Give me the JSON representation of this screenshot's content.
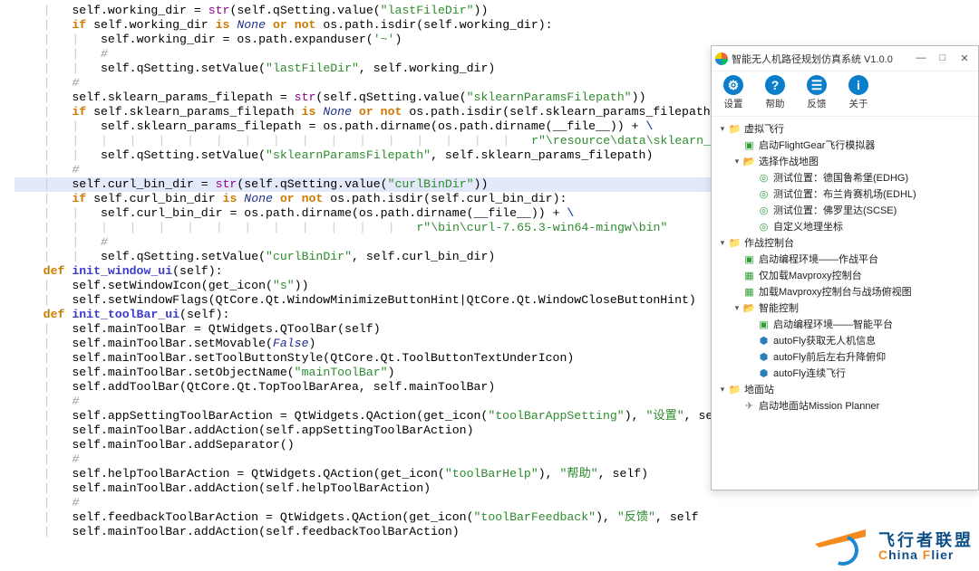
{
  "code": {
    "lines": [
      {
        "ind": 2,
        "segs": [
          [
            "sf",
            "self"
          ],
          [
            "op",
            ".working_dir = "
          ],
          [
            "builtin",
            "str"
          ],
          [
            "op",
            "(self.qSetting.value("
          ],
          [
            "str",
            "\"lastFileDir\""
          ],
          [
            "op",
            "))"
          ]
        ]
      },
      {
        "ind": 2,
        "segs": [
          [
            "kw",
            "if"
          ],
          [
            "op",
            " self.working_dir "
          ],
          [
            "kw",
            "is"
          ],
          [
            "op",
            " "
          ],
          [
            "none",
            "None"
          ],
          [
            "op",
            " "
          ],
          [
            "kw",
            "or"
          ],
          [
            "op",
            " "
          ],
          [
            "kw",
            "not"
          ],
          [
            "op",
            " os.path.isdir(self.working_dir):"
          ]
        ]
      },
      {
        "ind": 3,
        "segs": [
          [
            "sf",
            "self"
          ],
          [
            "op",
            ".working_dir = os.path.expanduser("
          ],
          [
            "str",
            "'~'"
          ],
          [
            "op",
            ")"
          ]
        ]
      },
      {
        "ind": 3,
        "segs": [
          [
            "cm",
            "#"
          ]
        ]
      },
      {
        "ind": 3,
        "segs": [
          [
            "sf",
            "self"
          ],
          [
            "op",
            ".qSetting.setValue("
          ],
          [
            "str",
            "\"lastFileDir\""
          ],
          [
            "op",
            ", self.working_dir)"
          ]
        ]
      },
      {
        "ind": 2,
        "segs": [
          [
            "cm",
            "#"
          ]
        ]
      },
      {
        "ind": 2,
        "segs": [
          [
            "sf",
            "self"
          ],
          [
            "op",
            ".sklearn_params_filepath = "
          ],
          [
            "builtin",
            "str"
          ],
          [
            "op",
            "(self.qSetting.value("
          ],
          [
            "str",
            "\"sklearnParamsFilepath\""
          ],
          [
            "op",
            "))"
          ]
        ]
      },
      {
        "ind": 2,
        "segs": [
          [
            "kw",
            "if"
          ],
          [
            "op",
            " self.sklearn_params_filepath "
          ],
          [
            "kw",
            "is"
          ],
          [
            "op",
            " "
          ],
          [
            "none",
            "None"
          ],
          [
            "op",
            " "
          ],
          [
            "kw",
            "or"
          ],
          [
            "op",
            " "
          ],
          [
            "kw",
            "not"
          ],
          [
            "op",
            " os.path.isdir(self.sklearn_params_filepath):"
          ]
        ]
      },
      {
        "ind": 3,
        "segs": [
          [
            "sf",
            "self"
          ],
          [
            "op",
            ".sklearn_params_filepath = os.path.dirname(os.path.dirname("
          ],
          [
            "id",
            "__file__"
          ],
          [
            "op",
            ")) + "
          ],
          [
            "esc",
            "\\"
          ]
        ]
      },
      {
        "ind": 18,
        "segs": [
          [
            "str",
            "r\"\\resource\\data\\sklearn_params.json\""
          ]
        ]
      },
      {
        "ind": 3,
        "segs": [
          [
            "sf",
            "self"
          ],
          [
            "op",
            ".qSetting.setValue("
          ],
          [
            "str",
            "\"sklearnParamsFilepath\""
          ],
          [
            "op",
            ", self.sklearn_params_filepath)"
          ]
        ]
      },
      {
        "ind": 2,
        "segs": [
          [
            "cm",
            "#"
          ]
        ]
      },
      {
        "hl": true,
        "ind": 2,
        "segs": [
          [
            "sf",
            "self"
          ],
          [
            "op",
            ".curl_bin_dir = "
          ],
          [
            "builtin",
            "str"
          ],
          [
            "op",
            "(self.qSetting.value("
          ],
          [
            "str",
            "\"curlBinDir\""
          ],
          [
            "op",
            "))"
          ]
        ]
      },
      {
        "ind": 2,
        "segs": [
          [
            "kw",
            "if"
          ],
          [
            "op",
            " self.curl_bin_dir "
          ],
          [
            "kw",
            "is"
          ],
          [
            "op",
            " "
          ],
          [
            "none",
            "None"
          ],
          [
            "op",
            " "
          ],
          [
            "kw",
            "or"
          ],
          [
            "op",
            " "
          ],
          [
            "kw",
            "not"
          ],
          [
            "op",
            " os.path.isdir(self.curl_bin_dir):"
          ]
        ]
      },
      {
        "ind": 3,
        "segs": [
          [
            "sf",
            "self"
          ],
          [
            "op",
            ".curl_bin_dir = os.path.dirname(os.path.dirname("
          ],
          [
            "id",
            "__file__"
          ],
          [
            "op",
            ")) + "
          ],
          [
            "esc",
            "\\"
          ]
        ]
      },
      {
        "ind": 14,
        "segs": [
          [
            "str",
            "r\"\\bin\\curl-7.65.3-win64-mingw\\bin\""
          ]
        ]
      },
      {
        "ind": 3,
        "segs": [
          [
            "cm",
            "#"
          ]
        ]
      },
      {
        "ind": 3,
        "segs": [
          [
            "sf",
            "self"
          ],
          [
            "op",
            ".qSetting.setValue("
          ],
          [
            "str",
            "\"curlBinDir\""
          ],
          [
            "op",
            ", self.curl_bin_dir)"
          ]
        ]
      },
      {
        "ind": 0,
        "segs": [
          [
            "op",
            ""
          ]
        ]
      },
      {
        "ind": 1,
        "segs": [
          [
            "kw",
            "def"
          ],
          [
            "op",
            " "
          ],
          [
            "fn",
            "init_window_ui"
          ],
          [
            "op",
            "(self):"
          ]
        ]
      },
      {
        "ind": 2,
        "segs": [
          [
            "sf",
            "self"
          ],
          [
            "op",
            ".setWindowIcon(get_icon("
          ],
          [
            "str",
            "\"s\""
          ],
          [
            "op",
            "))"
          ]
        ]
      },
      {
        "ind": 2,
        "segs": [
          [
            "sf",
            "self"
          ],
          [
            "op",
            ".setWindowFlags(QtCore.Qt.WindowMinimizeButtonHint|QtCore.Qt.WindowCloseButtonHint)"
          ]
        ]
      },
      {
        "ind": 0,
        "segs": [
          [
            "op",
            ""
          ]
        ]
      },
      {
        "ind": 1,
        "segs": [
          [
            "kw",
            "def"
          ],
          [
            "op",
            " "
          ],
          [
            "fn",
            "init_toolBar_ui"
          ],
          [
            "op",
            "(self):"
          ]
        ]
      },
      {
        "ind": 2,
        "segs": [
          [
            "sf",
            "self"
          ],
          [
            "op",
            ".mainToolBar = QtWidgets.QToolBar(self)"
          ]
        ]
      },
      {
        "ind": 2,
        "segs": [
          [
            "sf",
            "self"
          ],
          [
            "op",
            ".mainToolBar.setMovable("
          ],
          [
            "none",
            "False"
          ],
          [
            "op",
            ")"
          ]
        ]
      },
      {
        "ind": 2,
        "segs": [
          [
            "sf",
            "self"
          ],
          [
            "op",
            ".mainToolBar.setToolButtonStyle(QtCore.Qt.ToolButtonTextUnderIcon)"
          ]
        ]
      },
      {
        "ind": 2,
        "segs": [
          [
            "sf",
            "self"
          ],
          [
            "op",
            ".mainToolBar.setObjectName("
          ],
          [
            "str",
            "\"mainToolBar\""
          ],
          [
            "op",
            ")"
          ]
        ]
      },
      {
        "ind": 2,
        "segs": [
          [
            "sf",
            "self"
          ],
          [
            "op",
            ".addToolBar(QtCore.Qt.TopToolBarArea, self.mainToolBar)"
          ]
        ]
      },
      {
        "ind": 2,
        "segs": [
          [
            "cm",
            "#"
          ]
        ]
      },
      {
        "ind": 2,
        "segs": [
          [
            "sf",
            "self"
          ],
          [
            "op",
            ".appSettingToolBarAction = QtWidgets.QAction(get_icon("
          ],
          [
            "str",
            "\"toolBarAppSetting\""
          ],
          [
            "op",
            "), "
          ],
          [
            "str",
            "\"设置\""
          ],
          [
            "op",
            ", sel"
          ]
        ]
      },
      {
        "ind": 2,
        "segs": [
          [
            "sf",
            "self"
          ],
          [
            "op",
            ".mainToolBar.addAction(self.appSettingToolBarAction)"
          ]
        ]
      },
      {
        "ind": 2,
        "segs": [
          [
            "sf",
            "self"
          ],
          [
            "op",
            ".mainToolBar.addSeparator()"
          ]
        ]
      },
      {
        "ind": 2,
        "segs": [
          [
            "cm",
            "#"
          ]
        ]
      },
      {
        "ind": 2,
        "segs": [
          [
            "sf",
            "self"
          ],
          [
            "op",
            ".helpToolBarAction = QtWidgets.QAction(get_icon("
          ],
          [
            "str",
            "\"toolBarHelp\""
          ],
          [
            "op",
            "), "
          ],
          [
            "str",
            "\"帮助\""
          ],
          [
            "op",
            ", self)"
          ]
        ]
      },
      {
        "ind": 2,
        "segs": [
          [
            "sf",
            "self"
          ],
          [
            "op",
            ".mainToolBar.addAction(self.helpToolBarAction)"
          ]
        ]
      },
      {
        "ind": 2,
        "segs": [
          [
            "cm",
            "#"
          ]
        ]
      },
      {
        "ind": 2,
        "segs": [
          [
            "sf",
            "self"
          ],
          [
            "op",
            ".feedbackToolBarAction = QtWidgets.QAction(get_icon("
          ],
          [
            "str",
            "\"toolBarFeedback\""
          ],
          [
            "op",
            "), "
          ],
          [
            "str",
            "\"反馈\""
          ],
          [
            "op",
            ", self"
          ]
        ]
      },
      {
        "ind": 2,
        "segs": [
          [
            "sf",
            "self"
          ],
          [
            "op",
            ".mainToolBar.addAction(self.feedbackToolBarAction)"
          ]
        ]
      }
    ]
  },
  "app": {
    "title": "智能无人机路径规划仿真系统 V1.0.0",
    "winbtns": {
      "min": "—",
      "max": "□",
      "close": "✕"
    },
    "toolbar": [
      {
        "icon": "ic-gear",
        "glyph": "⚙",
        "name": "settings-button",
        "label": "设置"
      },
      {
        "icon": "ic-help",
        "glyph": "?",
        "name": "help-button",
        "label": "帮助"
      },
      {
        "icon": "ic-fb",
        "glyph": "☰",
        "name": "feedback-button",
        "label": "反馈"
      },
      {
        "icon": "ic-about",
        "glyph": "i",
        "name": "about-button",
        "label": "关于"
      }
    ],
    "tree": [
      {
        "d": 0,
        "tw": "exp",
        "ic": "ic-folder",
        "g": "📁",
        "label": "虚拟飞行",
        "name": "tree-group-virtual-flight"
      },
      {
        "d": 1,
        "tw": "none",
        "ic": "ic-term",
        "g": "▣",
        "label": "启动FlightGear飞行模拟器",
        "name": "tree-item-flightgear"
      },
      {
        "d": 1,
        "tw": "exp",
        "ic": "ic-folder",
        "g": "📂",
        "label": "选择作战地图",
        "name": "tree-group-select-map"
      },
      {
        "d": 2,
        "tw": "none",
        "ic": "ic-pin",
        "g": "◎",
        "label": "测试位置：德国鲁希堡(EDHG)",
        "name": "tree-item-pos-edhg"
      },
      {
        "d": 2,
        "tw": "none",
        "ic": "ic-pin",
        "g": "◎",
        "label": "测试位置：布兰肯赛机场(EDHL)",
        "name": "tree-item-pos-edhl"
      },
      {
        "d": 2,
        "tw": "none",
        "ic": "ic-pin",
        "g": "◎",
        "label": "测试位置：佛罗里达(SCSE)",
        "name": "tree-item-pos-scse"
      },
      {
        "d": 2,
        "tw": "none",
        "ic": "ic-pin",
        "g": "◎",
        "label": "自定义地理坐标",
        "name": "tree-item-custom-coord"
      },
      {
        "d": 0,
        "tw": "exp",
        "ic": "ic-folder",
        "g": "📁",
        "label": "作战控制台",
        "name": "tree-group-console"
      },
      {
        "d": 1,
        "tw": "none",
        "ic": "ic-term",
        "g": "▣",
        "label": "启动编程环境——作战平台",
        "name": "tree-item-env-combat"
      },
      {
        "d": 1,
        "tw": "none",
        "ic": "ic-grid",
        "g": "▦",
        "label": "仅加载Mavproxy控制台",
        "name": "tree-item-mavproxy"
      },
      {
        "d": 1,
        "tw": "none",
        "ic": "ic-grid",
        "g": "▦",
        "label": "加载Mavproxy控制台与战场俯视图",
        "name": "tree-item-mavproxy-topview"
      },
      {
        "d": 1,
        "tw": "exp",
        "ic": "ic-folder",
        "g": "📂",
        "label": "智能控制",
        "name": "tree-group-ai-control"
      },
      {
        "d": 2,
        "tw": "none",
        "ic": "ic-term",
        "g": "▣",
        "label": "启动编程环境——智能平台",
        "name": "tree-item-env-ai"
      },
      {
        "d": 2,
        "tw": "none",
        "ic": "ic-py",
        "g": "⬢",
        "label": "autoFly获取无人机信息",
        "name": "tree-item-autofly-info"
      },
      {
        "d": 2,
        "tw": "none",
        "ic": "ic-py",
        "g": "⬢",
        "label": "autoFly前后左右升降俯仰",
        "name": "tree-item-autofly-move"
      },
      {
        "d": 2,
        "tw": "none",
        "ic": "ic-py",
        "g": "⬢",
        "label": "autoFly连续飞行",
        "name": "tree-item-autofly-loop"
      },
      {
        "d": 0,
        "tw": "exp",
        "ic": "ic-folder",
        "g": "📁",
        "label": "地面站",
        "name": "tree-group-ground"
      },
      {
        "d": 1,
        "tw": "none",
        "ic": "ic-mp",
        "g": "✈",
        "label": "启动地面站Mission Planner",
        "name": "tree-item-mission-planner"
      }
    ]
  },
  "logo": {
    "cn": "飞行者联盟",
    "en_a": "C",
    "en_b": "hina ",
    "en_c": "F",
    "en_d": "lier"
  }
}
